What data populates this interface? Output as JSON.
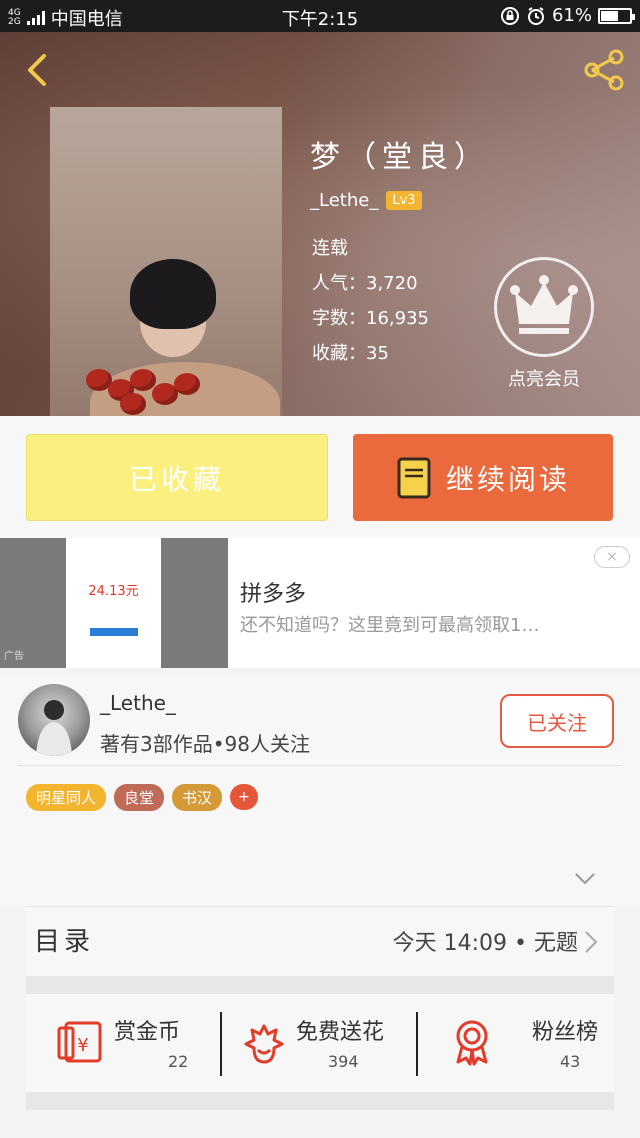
{
  "status_bar": {
    "network": "4G",
    "network2": "2G",
    "carrier": "中国电信",
    "time": "下午2:15",
    "battery": "61%",
    "battery_level": 0.61
  },
  "header": {
    "back_icon": "chevron-left-icon",
    "share_icon": "share-icon"
  },
  "book": {
    "title": "梦（堂良）",
    "author": "_Lethe_",
    "level": "Lv3",
    "status": "连载",
    "popularity": "人气：3,720",
    "word_count": "字数：16,935",
    "favorites": "收藏：35",
    "vip_label": "点亮会员"
  },
  "actions": {
    "collected_label": "已收藏",
    "continue_label": "继续阅读"
  },
  "ad": {
    "tag": "广告",
    "amount": "24.13元",
    "title": "拼多多",
    "description": "还不知道吗？这里竟到可最高领取1…",
    "close_label": "×"
  },
  "author_section": {
    "name": "_Lethe_",
    "stats": "著有3部作品•98人关注",
    "follow_label": "已关注",
    "tags": [
      {
        "label": "明星同人",
        "color": "#f3b52f"
      },
      {
        "label": "良堂",
        "color": "#c06a58"
      },
      {
        "label": "书汉",
        "color": "#d49a38"
      }
    ],
    "add_tag_label": "+"
  },
  "catalog": {
    "title": "目录",
    "latest": "今天 14:09 • 无题"
  },
  "stats": [
    {
      "label": "赏金币",
      "value": "22",
      "icon": "red-envelope-icon"
    },
    {
      "label": "免费送花",
      "value": "394",
      "icon": "flower-icon"
    },
    {
      "label": "粉丝榜",
      "value": "43",
      "icon": "ribbon-badge-icon"
    }
  ],
  "colors": {
    "accent": "#ea6a3e",
    "collect_bg": "#fbf07f",
    "icon_red": "#e23b2a"
  }
}
